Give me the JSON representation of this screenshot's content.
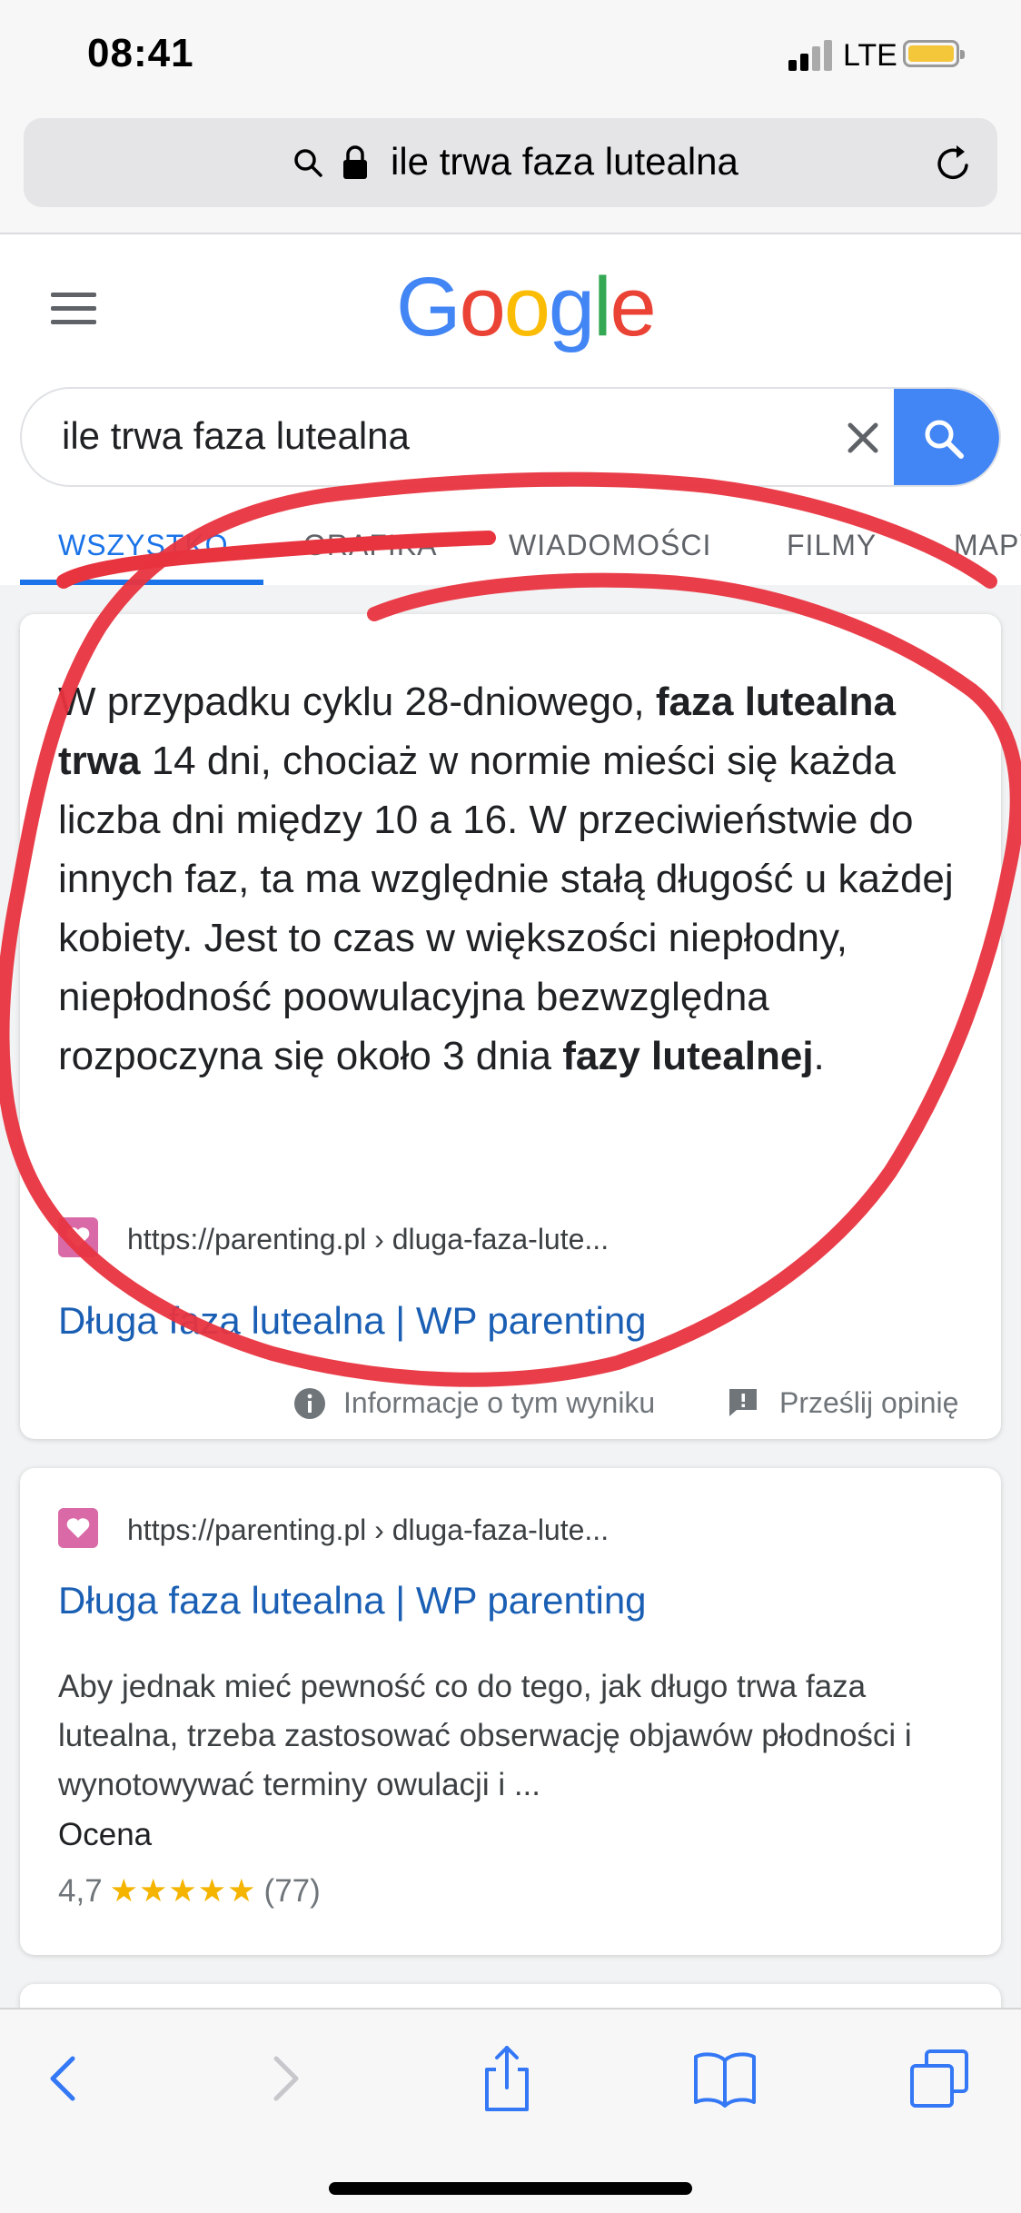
{
  "status_bar": {
    "time": "08:41",
    "network": "LTE",
    "battery_color": "#f4c73b"
  },
  "browser": {
    "url_text": "ile trwa faza lutealna"
  },
  "google": {
    "logo_letters": [
      {
        "char": "G",
        "color": "#4285F4"
      },
      {
        "char": "o",
        "color": "#EA4335"
      },
      {
        "char": "o",
        "color": "#FBBC05"
      },
      {
        "char": "g",
        "color": "#4285F4"
      },
      {
        "char": "l",
        "color": "#34A853"
      },
      {
        "char": "e",
        "color": "#EA4335"
      }
    ]
  },
  "search": {
    "query": "ile trwa faza lutealna"
  },
  "tabs": [
    {
      "label": "WSZYSTKO",
      "active": true
    },
    {
      "label": "GRAFIKA",
      "active": false
    },
    {
      "label": "WIADOMOŚCI",
      "active": false
    },
    {
      "label": "FILMY",
      "active": false
    },
    {
      "label": "MAPY",
      "active": false
    }
  ],
  "featured_snippet": {
    "text_parts": [
      {
        "text": "W przypadku cyklu 28-dniowego, ",
        "bold": false
      },
      {
        "text": "faza lutealna trwa",
        "bold": true
      },
      {
        "text": " 14 dni, chociaż w normie mieści się każda liczba dni między 10 a 16. W przeciwieństwie do innych faz, ta ma względnie stałą długość u każdej kobiety. Jest to czas w większości niepłodny, niepłodność poowulacyjna bezwzględna rozpoczyna się około 3 dnia ",
        "bold": false
      },
      {
        "text": "fazy lutealnej",
        "bold": true
      },
      {
        "text": ".",
        "bold": false
      }
    ],
    "source_url": "https://parenting.pl › dluga-faza-lute...",
    "title": "Długa faza lutealna | WP parenting",
    "info_label": "Informacje o tym wyniku",
    "feedback_label": "Prześlij opinię"
  },
  "result": {
    "source_url": "https://parenting.pl › dluga-faza-lute...",
    "title": "Długa faza lutealna | WP parenting",
    "description": "Aby jednak mieć pewność co do tego, jak długo trwa faza lutealna, trzeba zastosować obserwację objawów płodności i wynotowywać terminy owulacji i ...",
    "rating_label": "Ocena",
    "rating_value": "4,7",
    "stars": "★★★★★",
    "rating_count": "(77)"
  },
  "annotation": {
    "color": "#e8343f"
  }
}
